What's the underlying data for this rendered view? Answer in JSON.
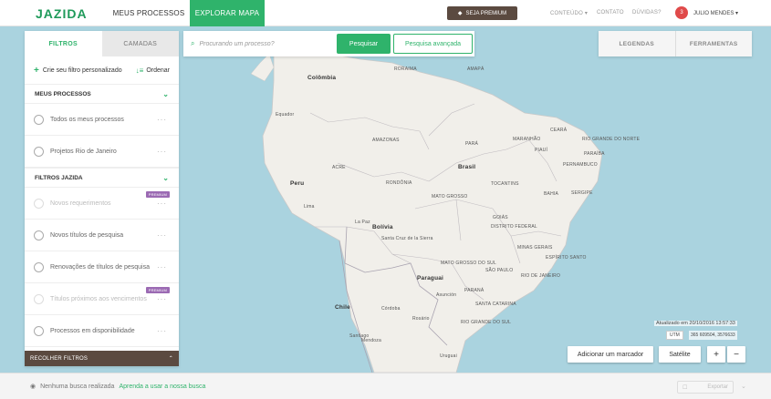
{
  "brand": {
    "logo": "JAZIDA"
  },
  "nav": {
    "meus_processos": "MEUS PROCESSOS",
    "explorar_mapa": "EXPLORAR MAPA",
    "premium": "SEJA PREMIUM",
    "conteudo": "CONTEÚDO",
    "contato": "CONTATO",
    "duvidas": "DÚVIDAS?",
    "user_initial": "3",
    "user_name": "JULIO MENDES"
  },
  "panel": {
    "tabs": [
      "FILTROS",
      "CAMADAS"
    ],
    "create_filter": "Crie seu filtro personalizado",
    "order": "Ordenar",
    "sections": [
      {
        "title": "MEUS PROCESSOS",
        "items": [
          {
            "label": "Todos os meus processos"
          },
          {
            "label": "Projetos Rio de Janeiro"
          }
        ]
      },
      {
        "title": "FILTROS JAZIDA",
        "items": [
          {
            "label": "Novos requerimentos",
            "badge": "PREMIUM"
          },
          {
            "label": "Novos títulos de pesquisa"
          },
          {
            "label": "Renovações de títulos de pesquisa"
          },
          {
            "label": "Títulos próximos aos vencimentos",
            "badge": "PREMIUM"
          },
          {
            "label": "Processos em disponibilidade"
          }
        ]
      }
    ],
    "collapse": "RECOLHER FILTROS"
  },
  "search": {
    "placeholder": "Procurando um processo?",
    "submit": "Pesquisar",
    "advanced": "Pesquisa avançada"
  },
  "right_tabs": [
    "LEGENDAS",
    "FERRAMENTAS"
  ],
  "map": {
    "countries": [
      "Colômbia",
      "Equador",
      "Peru",
      "Brasil",
      "Bolívia",
      "Paraguai",
      "Chile"
    ],
    "labels": [
      "AMAPÁ",
      "RORAIMA",
      "AMAZONAS",
      "PARÁ",
      "MARANHÃO",
      "CEARÁ",
      "RIO GRANDE DO NORTE",
      "PARAÍBA",
      "PIAUÍ",
      "PERNAMBUCO",
      "ACRE",
      "RONDÔNIA",
      "MATO GROSSO",
      "TOCANTINS",
      "BAHIA",
      "SERGIPE",
      "GOIÁS",
      "DISTRITO FEDERAL",
      "MINAS GERAIS",
      "ESPÍRITO SANTO",
      "MATO GROSSO DO SUL",
      "SÃO PAULO",
      "RIO DE JANEIRO",
      "PARANÁ",
      "SANTA CATARINA",
      "RIO GRANDE DO SUL",
      "Uruguai",
      "La Paz",
      "Asunción",
      "Santa Cruz de la Sierra",
      "Santiago",
      "Córdoba",
      "Rosário",
      "Mendoza",
      "Lima"
    ],
    "updated": "Atualizado em 20/10/2016 13:57:33",
    "projection": "UTM",
    "coords": "365 609504, 3576633",
    "add_marker": "Adicionar um marcador",
    "satellite": "Satélite",
    "zoom_in": "+",
    "zoom_out": "−"
  },
  "footer": {
    "status": "Nenhuma busca realizada",
    "learn": "Aprenda a usar a nossa busca",
    "export": "Exportar"
  },
  "colors": {
    "accent": "#2fb36b",
    "brown": "#5b4a40",
    "ocean": "#aad3df",
    "land": "#f1efea"
  }
}
